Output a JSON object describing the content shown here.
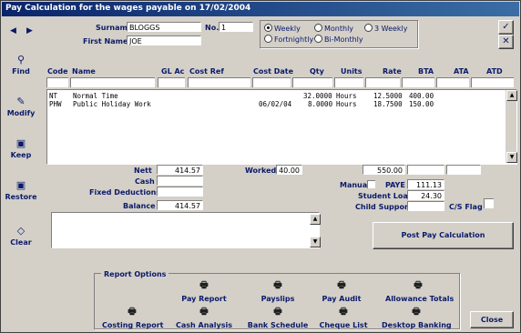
{
  "window": {
    "title": "Pay Calculation for the wages payable on 17/02/2004"
  },
  "nav": {
    "prev": "◀",
    "next": "▶"
  },
  "employee": {
    "surname_label": "Surname",
    "surname": "BLOGGS",
    "firstname_label": "First Name",
    "firstname": "JOE",
    "no_label": "No.",
    "no": "1"
  },
  "frequency": {
    "options": [
      "Weekly",
      "Monthly",
      "3 Weekly",
      "Fortnightly",
      "Bi-Monthly"
    ],
    "selected": "Weekly"
  },
  "side": {
    "find": "Find",
    "modify": "Modify",
    "keep": "Keep",
    "restore": "Restore",
    "clear": "Clear"
  },
  "columns": [
    "Code",
    "Name",
    "GL Ac",
    "Cost Ref",
    "Cost Date",
    "Qty",
    "Units",
    "Rate",
    "BTA",
    "ATA",
    "ATD"
  ],
  "rows": [
    {
      "code": "NT",
      "name": "Normal Time",
      "cost_date": "",
      "qty": "32.0000",
      "units": "Hours",
      "rate": "12.5000",
      "bta": "400.00"
    },
    {
      "code": "PHW",
      "name": "Public Holiday Work",
      "cost_date": "06/02/04",
      "qty": "8.0000",
      "units": "Hours",
      "rate": "18.7500",
      "bta": "150.00"
    }
  ],
  "totals": {
    "nett_label": "Nett",
    "nett": "414.57",
    "cash_label": "Cash",
    "fixed_label": "Fixed Deductions",
    "balance_label": "Balance",
    "balance": "414.57",
    "worked_label": "Worked",
    "worked": "40.00",
    "bta_total": "550.00",
    "manual_label": "Manual",
    "paye_label": "PAYE",
    "paye": "111.13",
    "loan_label": "Student Loan",
    "loan": "24.30",
    "child_label": "Child Support",
    "cs_label": "C/S Flag"
  },
  "buttons": {
    "post": "Post Pay Calculation",
    "close": "Close"
  },
  "reports": {
    "title": "Report Options",
    "row1": [
      "Pay Report",
      "Payslips",
      "Pay Audit",
      "Allowance Totals"
    ],
    "row2": [
      "Costing Report",
      "Cash Analysis",
      "Bank Schedule",
      "Cheque List",
      "Desktop Banking"
    ]
  }
}
